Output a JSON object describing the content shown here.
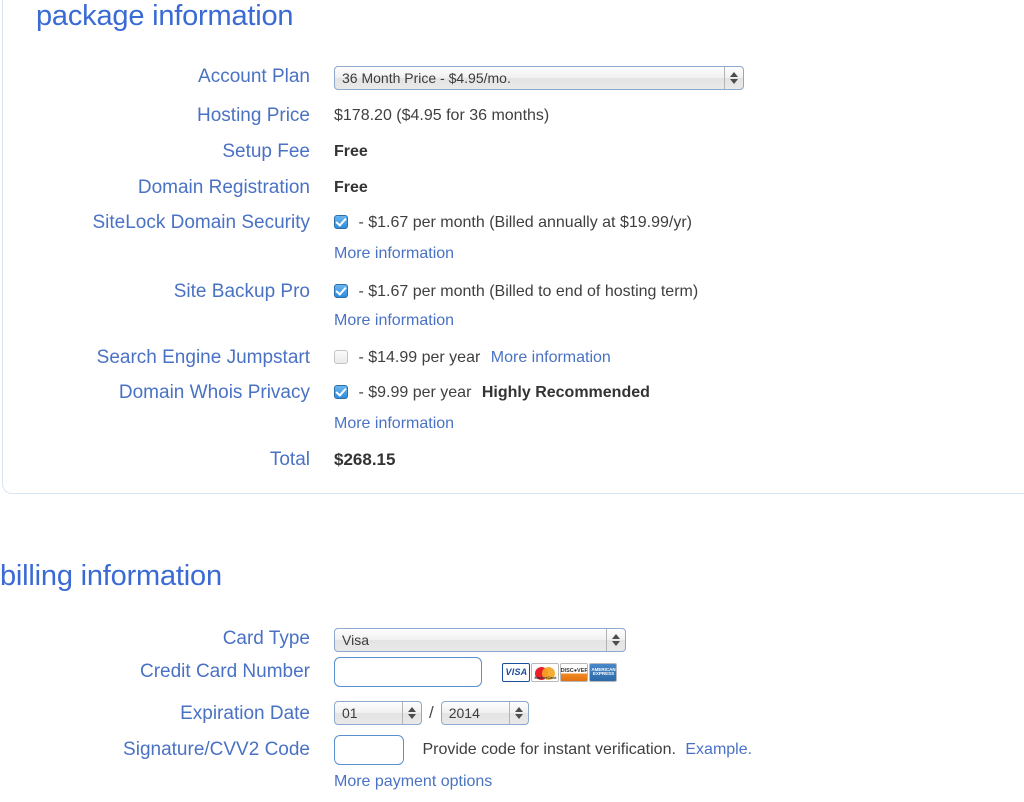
{
  "package": {
    "title": "package information",
    "rows": {
      "account_plan": {
        "label": "Account Plan",
        "selected": "36 Month Price - $4.95/mo."
      },
      "hosting_price": {
        "label": "Hosting Price",
        "value": "$178.20  ($4.95 for 36 months)"
      },
      "setup_fee": {
        "label": "Setup Fee",
        "value": "Free"
      },
      "domain_registration": {
        "label": "Domain Registration",
        "value": "Free"
      },
      "sitelock": {
        "label": "SiteLock Domain Security",
        "checked": true,
        "value": "- $1.67 per month (Billed annually at $19.99/yr)",
        "more_link": "More information"
      },
      "site_backup": {
        "label": "Site Backup Pro",
        "checked": true,
        "value": "- $1.67 per month (Billed to end of hosting term)",
        "more_link": "More information"
      },
      "search_engine": {
        "label": "Search Engine Jumpstart",
        "checked": false,
        "value": "- $14.99 per year",
        "more_link": "More information"
      },
      "whois_privacy": {
        "label": "Domain Whois Privacy",
        "checked": true,
        "value": "- $9.99 per year",
        "emphasis": "Highly Recommended",
        "more_link": "More information"
      },
      "total": {
        "label": "Total",
        "value": "$268.15"
      }
    }
  },
  "billing": {
    "title": "billing information",
    "rows": {
      "card_type": {
        "label": "Card Type",
        "selected": "Visa"
      },
      "card_number": {
        "label": "Credit Card Number",
        "value": "",
        "placeholder": "",
        "accepted_cards": [
          "VISA",
          "MasterCard",
          "DISCOVER",
          "AMERICAN EXPRESS"
        ]
      },
      "expiration": {
        "label": "Expiration Date",
        "month": "01",
        "separator": "/",
        "year": "2014"
      },
      "cvv": {
        "label": "Signature/CVV2 Code",
        "value": "",
        "placeholder": "",
        "note": "Provide code for instant verification.",
        "example_link": "Example."
      },
      "more_payment": {
        "link": "More payment options"
      }
    }
  },
  "colors": {
    "heading_blue": "#3a6ad4",
    "label_blue": "#4a72c4",
    "link_blue": "#4a72c4",
    "value_grey": "#3f3f3f",
    "panel_border": "#d6e6f4",
    "checkbox_on": "#2f8ddb"
  }
}
